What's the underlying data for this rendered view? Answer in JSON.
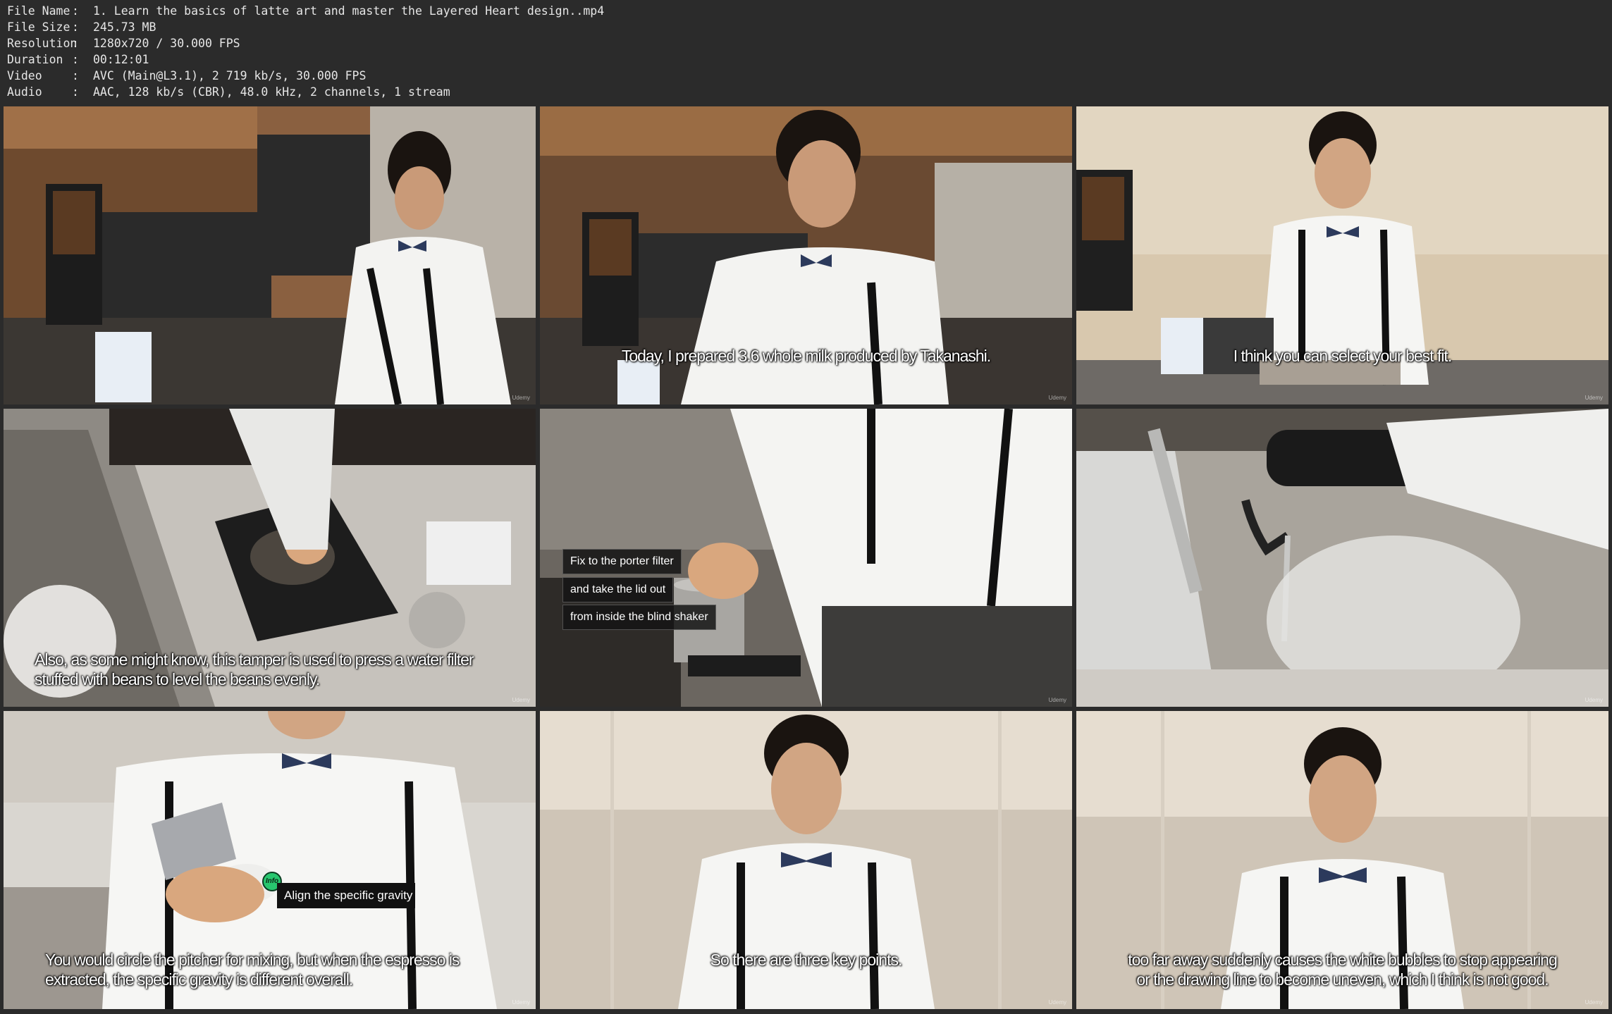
{
  "metadata": {
    "rows": [
      {
        "key": "File Name",
        "value": "1. Learn the basics of latte art and master the Layered Heart design..mp4"
      },
      {
        "key": "File Size",
        "value": "245.73 MB"
      },
      {
        "key": "Resolution",
        "value": "1280x720 / 30.000 FPS"
      },
      {
        "key": "Duration",
        "value": "00:12:01"
      },
      {
        "key": "Video",
        "value": "AVC (Main@L3.1), 2 719 kb/s, 30.000 FPS"
      },
      {
        "key": "Audio",
        "value": "AAC, 128 kb/s (CBR), 48.0 kHz, 2 channels, 1 stream"
      }
    ],
    "separator": ":"
  },
  "watermark": "Udemy",
  "frames": [
    {
      "subtitle": ""
    },
    {
      "subtitle": "Today, I prepared 3.6 whole milk produced by Takanashi."
    },
    {
      "subtitle": "I think you can select your best fit."
    },
    {
      "subtitle_lines": [
        "Also, as some might know, this tamper is used to press a water filter",
        "stuffed with beans to level the beans evenly."
      ]
    },
    {
      "boxes": [
        "Fix to the porter filter",
        "and take the lid out",
        "from inside the blind shaker"
      ]
    },
    {
      "subtitle": ""
    },
    {
      "info_label": "Info",
      "info_text": "Align the specific gravity o",
      "subtitle_lines": [
        "You would circle the pitcher for mixing, but when the espresso is",
        "extracted, the specific gravity is different overall."
      ]
    },
    {
      "subtitle": "So there are three key points."
    },
    {
      "subtitle_lines": [
        "too far away suddenly causes the white bubbles to stop appearing",
        "or the drawing line to become uneven, which I think is not good."
      ]
    }
  ],
  "colors": {
    "background": "#2b2b2b",
    "meta_text": "#e6e6e6",
    "info_green": "#28c76f"
  }
}
